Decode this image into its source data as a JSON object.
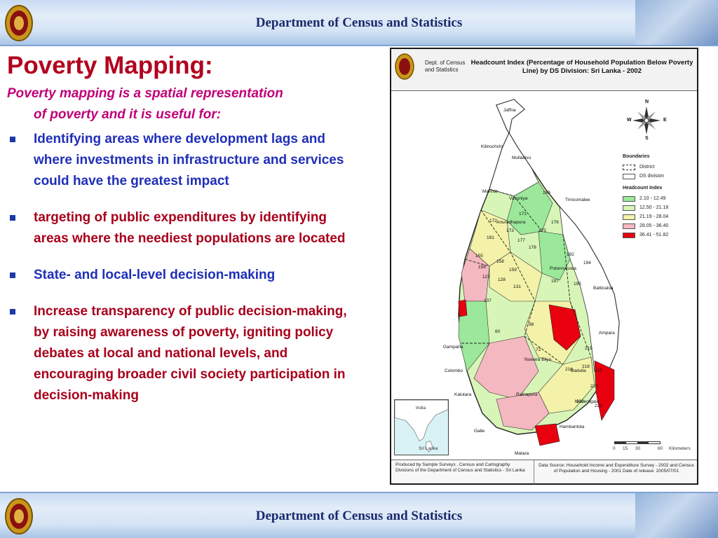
{
  "banner": {
    "title": "Department of Census and Statistics",
    "bg_color": "#c9dbf2",
    "title_color": "#1a2a6b"
  },
  "heading": "Poverty Mapping:",
  "subheading": {
    "line1": "Poverty mapping is a spatial representation",
    "line2": "of poverty and it is useful for:"
  },
  "bullets": [
    {
      "text": "Identifying areas where development lags and where investments in infrastructure and services could have the greatest impact",
      "color": "blue"
    },
    {
      "text": "targeting of public expenditures by identifying areas where the neediest populations are located",
      "color": "red"
    },
    {
      "text": "State- and local-level decision-making",
      "color": "blue"
    },
    {
      "text": "Increase transparency of public decision-making, by raising awareness of poverty, igniting policy debates at local and national levels, and encouraging broader civil society participation in decision-making",
      "color": "red"
    }
  ],
  "map": {
    "dept": "Dept. of Census and Statistics",
    "title": "Headcount Index (Percentage of Household Population Below Poverty Line) by DS Division: Sri Lanka - 2002",
    "legend": {
      "boundaries_title": "Boundaries",
      "district": "District",
      "ds_division": "DS division",
      "headcount_title": "Headcount Index",
      "classes": [
        {
          "label": "2.10 - 12.49",
          "color": "#9be89b"
        },
        {
          "label": "12.50 - 21.18",
          "color": "#d8f5b8"
        },
        {
          "label": "21.19 - 28.04",
          "color": "#f3f2a8"
        },
        {
          "label": "28.05 - 36.40",
          "color": "#f4b8c0"
        },
        {
          "label": "36.41 - 51.82",
          "color": "#e8000e"
        }
      ]
    },
    "places": [
      "Jaffna",
      "Kilinochchi",
      "Mullaitivu",
      "Mannar",
      "Vavuniya",
      "Trincomalee",
      "Batticaloa",
      "Gampaha",
      "Colombo",
      "Kalutara",
      "Galle",
      "Matara",
      "Ampara",
      "Nuwara Eliya",
      "Ratnapura",
      "Anuradhapura",
      "Polonnaruwa",
      "Badulla",
      "Moneragala",
      "Hambantota"
    ],
    "division_numbers": [
      "169",
      "171",
      "172",
      "173",
      "175",
      "176",
      "177",
      "178",
      "181",
      "192",
      "194",
      "195",
      "197",
      "127",
      "128",
      "131",
      "137",
      "155",
      "156",
      "158",
      "159",
      "216",
      "217",
      "218",
      "219",
      "220",
      "221",
      "222",
      "60",
      "72",
      "98"
    ],
    "inset": {
      "india": "India",
      "srilanka": "Sri Lanka"
    },
    "scale": {
      "ticks": [
        "0",
        "15",
        "30",
        "60"
      ],
      "unit": "Kilometers"
    },
    "compass": {
      "n": "N",
      "s": "S",
      "e": "E",
      "w": "W"
    },
    "produced_by": "Produced by Sample Surveys , Census and Cartography Divisions of the Department of Census and Statistics - Sri Lanka",
    "data_source": "Data Source: Household Income and Expenditure Survey - 2002 and Census of Population and Housing - 2001 Date of release: 2005/07/01"
  }
}
